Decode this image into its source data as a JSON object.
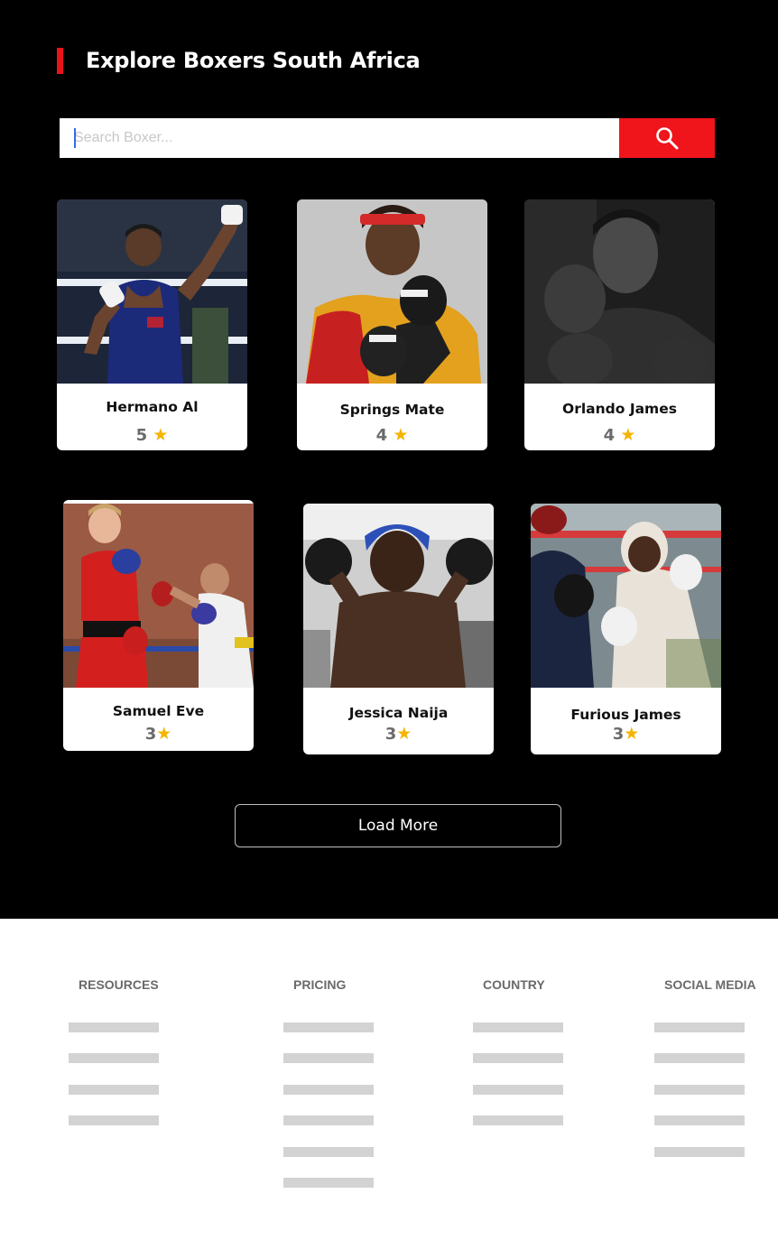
{
  "page": {
    "title": "Explore Boxers South Africa"
  },
  "search": {
    "placeholder": "Search Boxer...",
    "value": "",
    "button_icon": "search-icon"
  },
  "boxers": [
    {
      "name": "Hermano Al",
      "rating": "5",
      "rating_icon": "star-icon"
    },
    {
      "name": "Springs Mate",
      "rating": "4",
      "rating_icon": "star-icon"
    },
    {
      "name": "Orlando James",
      "rating": "4",
      "rating_icon": "star-icon"
    },
    {
      "name": "Samuel Eve",
      "rating": "3",
      "rating_icon": "star-icon"
    },
    {
      "name": "Jessica Naija",
      "rating": "3",
      "rating_icon": "star-icon"
    },
    {
      "name": "Furious James",
      "rating": "3",
      "rating_icon": "star-icon"
    }
  ],
  "load_more_label": "Load More",
  "footer": {
    "columns": [
      {
        "title": "RESOURCES",
        "placeholder_lines": 4
      },
      {
        "title": "PRICING",
        "placeholder_lines": 6
      },
      {
        "title": "COUNTRY",
        "placeholder_lines": 4
      },
      {
        "title": "SOCIAL MEDIA",
        "placeholder_lines": 5
      }
    ]
  },
  "colors": {
    "accent": "#f0141b",
    "background_dark": "#000000",
    "star": "#f4b400",
    "placeholder_gray": "#d3d3d3"
  }
}
